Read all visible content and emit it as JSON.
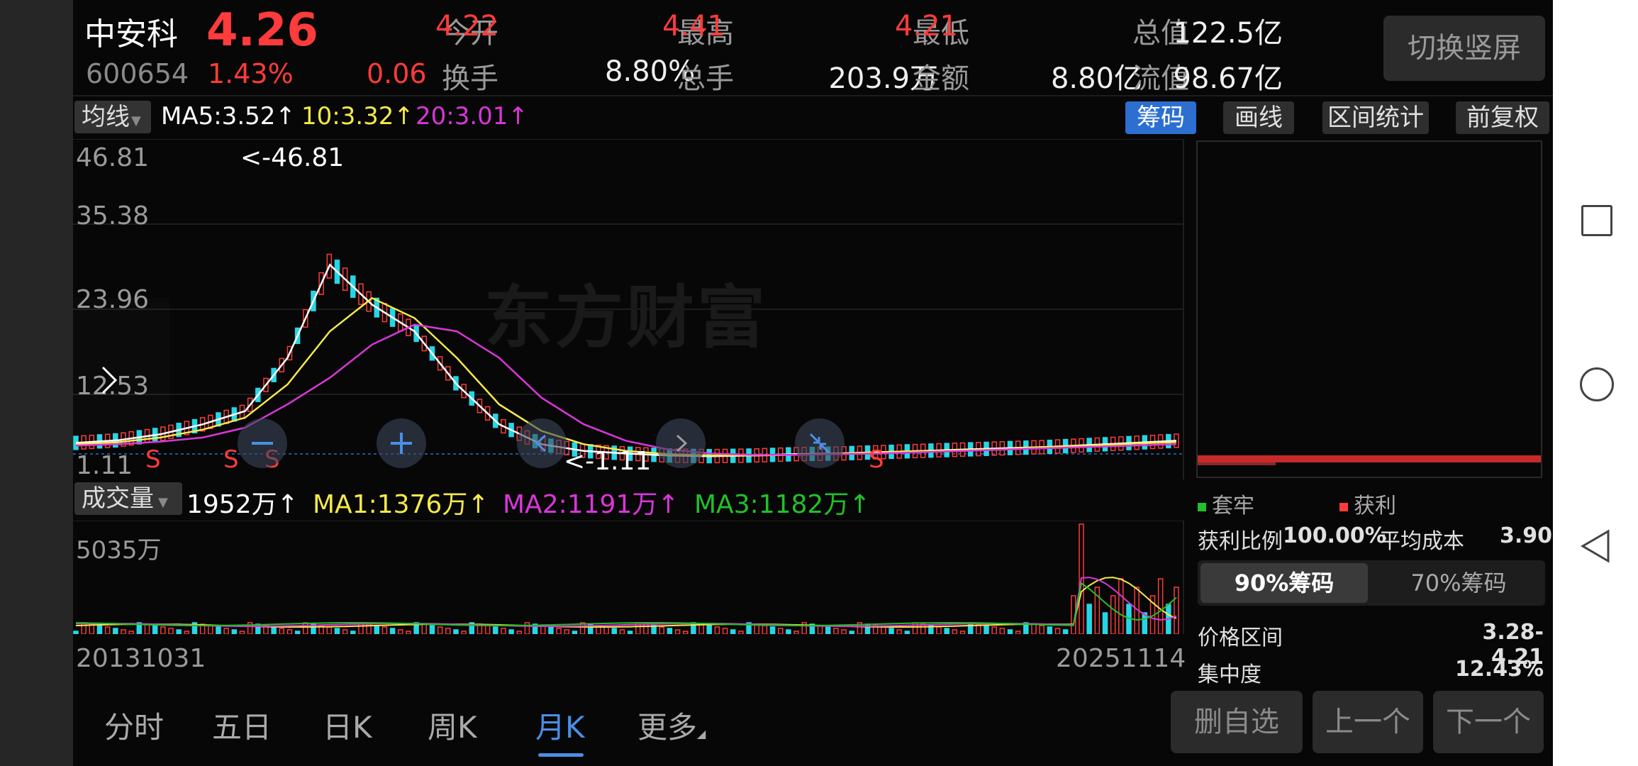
{
  "header": {
    "name": "中安科",
    "price": "4.26",
    "code": "600654",
    "change_pct": "1.43%",
    "change": "0.06",
    "quotes": [
      {
        "label": "今开",
        "value": "4.22",
        "color": "#ff3b3b"
      },
      {
        "label": "最高",
        "value": "4.41",
        "color": "#ff3b3b"
      },
      {
        "label": "最低",
        "value": "4.21",
        "color": "#ff3b3b"
      },
      {
        "label": "总值",
        "value": "122.5亿",
        "color": "#f0f0f0"
      },
      {
        "label": "换手",
        "value": "8.80%",
        "color": "#f0f0f0"
      },
      {
        "label": "总手",
        "value": "203.9万",
        "color": "#f0f0f0"
      },
      {
        "label": "金额",
        "value": "8.80亿",
        "color": "#f0f0f0"
      },
      {
        "label": "流值",
        "value": "98.67亿",
        "color": "#f0f0f0"
      }
    ],
    "switch_btn": "切换竖屏"
  },
  "toolbar": {
    "ma_select": "均线",
    "ma5": "MA5:3.52↑",
    "ma10": "10:3.32↑",
    "ma20": "20:3.01↑",
    "buttons": [
      "筹码",
      "画线",
      "区间统计",
      "前复权"
    ]
  },
  "price_axis": [
    "46.81",
    "35.38",
    "23.96",
    "12.53",
    "1.11"
  ],
  "annotations": {
    "high": "<-46.81",
    "low": "<-1.11",
    "s_marks": [
      "S",
      "S",
      "S",
      "S"
    ]
  },
  "watermark": "东方财富",
  "volume": {
    "select": "成交量",
    "current": "1952万↑",
    "ma1": "MA1:1376万↑",
    "ma2": "MA2:1191万↑",
    "ma3": "MA3:1182万↑",
    "axis_top": "5035万"
  },
  "dates": {
    "start": "20131031",
    "end": "20251114"
  },
  "chip_panel": {
    "legend_trapped": "套牢",
    "legend_profit": "获利",
    "profit_ratio_label": "获利比例",
    "profit_ratio": "100.00%",
    "avg_cost_label": "平均成本",
    "avg_cost": "3.90",
    "tab90": "90%筹码",
    "tab70": "70%筹码",
    "range_label": "价格区间",
    "range": "3.28-4.21",
    "concentration_label": "集中度",
    "concentration": "12.43%"
  },
  "tabs": [
    "分时",
    "五日",
    "日K",
    "周K",
    "月K",
    "更多"
  ],
  "active_tab": "月K",
  "bottom_buttons": [
    "删自选",
    "上一个",
    "下一个"
  ],
  "colors": {
    "up": "#ff3b3b",
    "down": "#27d6e6",
    "ma5": "#ffffff",
    "ma10": "#f5e94a",
    "ma20": "#d936d9",
    "ma_green": "#22c02a",
    "accent": "#2c6fd1"
  },
  "chart_data": {
    "type": "line",
    "title": "",
    "ylim": [
      1.11,
      46.81
    ],
    "series": [
      {
        "name": "MA5",
        "values": [
          3.2,
          3.6,
          4.5,
          6,
          8,
          16,
          30,
          24,
          20,
          12,
          6,
          3,
          2,
          1.6,
          1.3,
          1.2,
          1.3,
          1.5,
          1.6,
          1.8,
          2,
          2.2,
          2.4,
          2.6,
          2.9,
          3.2,
          3.52
        ]
      },
      {
        "name": "10",
        "values": [
          3.0,
          3.3,
          4,
          5.2,
          7,
          12,
          20,
          25,
          22,
          16,
          9,
          5,
          3,
          2,
          1.5,
          1.3,
          1.3,
          1.4,
          1.6,
          1.8,
          2,
          2.1,
          2.3,
          2.6,
          2.8,
          3.1,
          3.32
        ]
      },
      {
        "name": "20",
        "values": [
          2.8,
          3,
          3.4,
          4,
          5.5,
          9,
          13,
          18,
          21,
          20,
          16,
          10,
          6,
          3.5,
          2.2,
          1.6,
          1.4,
          1.4,
          1.5,
          1.6,
          1.8,
          2,
          2.2,
          2.4,
          2.6,
          2.8,
          3.01
        ]
      }
    ]
  }
}
